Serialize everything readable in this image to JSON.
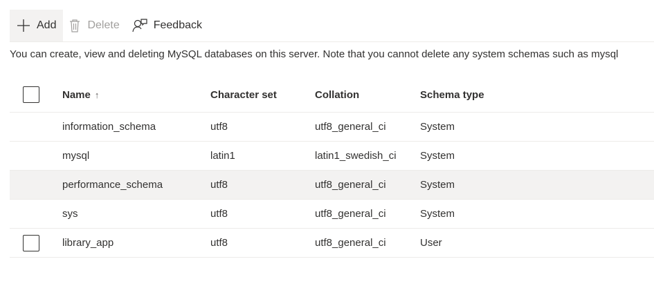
{
  "toolbar": {
    "add_label": "Add",
    "delete_label": "Delete",
    "feedback_label": "Feedback"
  },
  "info_text": "You can create, view and deleting MySQL databases on this server. Note that you cannot delete any system schemas such as mysql",
  "table": {
    "headers": {
      "name": "Name",
      "sort_indicator": "↑",
      "charset": "Character set",
      "collation": "Collation",
      "schema_type": "Schema type"
    },
    "rows": [
      {
        "name": "information_schema",
        "charset": "utf8",
        "collation": "utf8_general_ci",
        "schema_type": "System"
      },
      {
        "name": "mysql",
        "charset": "latin1",
        "collation": "latin1_swedish_ci",
        "schema_type": "System"
      },
      {
        "name": "performance_schema",
        "charset": "utf8",
        "collation": "utf8_general_ci",
        "schema_type": "System"
      },
      {
        "name": "sys",
        "charset": "utf8",
        "collation": "utf8_general_ci",
        "schema_type": "System"
      },
      {
        "name": "library_app",
        "charset": "utf8",
        "collation": "utf8_general_ci",
        "schema_type": "User"
      }
    ]
  },
  "colors": {
    "hover_row": "#f3f2f1",
    "disabled_text": "#a19f9d",
    "divider": "#edebe9"
  }
}
